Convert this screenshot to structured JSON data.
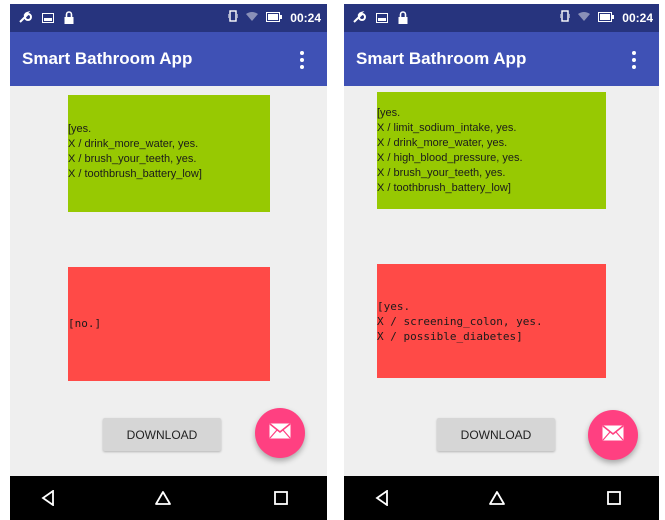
{
  "screens": [
    {
      "status": {
        "time": "00:24"
      },
      "app_title": "Smart Bathroom App",
      "green_box": "[yes.\nX / drink_more_water, yes.\nX / brush_your_teeth, yes.\nX / toothbrush_battery_low]",
      "red_box": "[no.]",
      "download_label": "DOWNLOAD"
    },
    {
      "status": {
        "time": "00:24"
      },
      "app_title": "Smart Bathroom App",
      "green_box": "[yes.\nX / limit_sodium_intake, yes.\nX / drink_more_water, yes.\nX / high_blood_pressure, yes.\nX / brush_your_teeth, yes.\nX / toothbrush_battery_low]",
      "red_box": "[yes.\nX / screening_colon, yes.\nX / possible_diabetes]",
      "download_label": "DOWNLOAD"
    }
  ],
  "icons": {
    "status_left": [
      "wrench-icon",
      "image-icon",
      "lock-icon"
    ],
    "status_right": [
      "vibrate-icon",
      "wifi-icon",
      "battery-icon"
    ],
    "appbar": "more-vert-icon",
    "fab": "email-icon",
    "nav": [
      "back-icon",
      "home-icon",
      "recents-icon"
    ]
  },
  "colors": {
    "status_bar": "#27347e",
    "app_bar": "#3f51b5",
    "green_box": "#97c902",
    "red_box": "#ff4a47",
    "fab": "#ff4081",
    "background": "#efefef"
  }
}
